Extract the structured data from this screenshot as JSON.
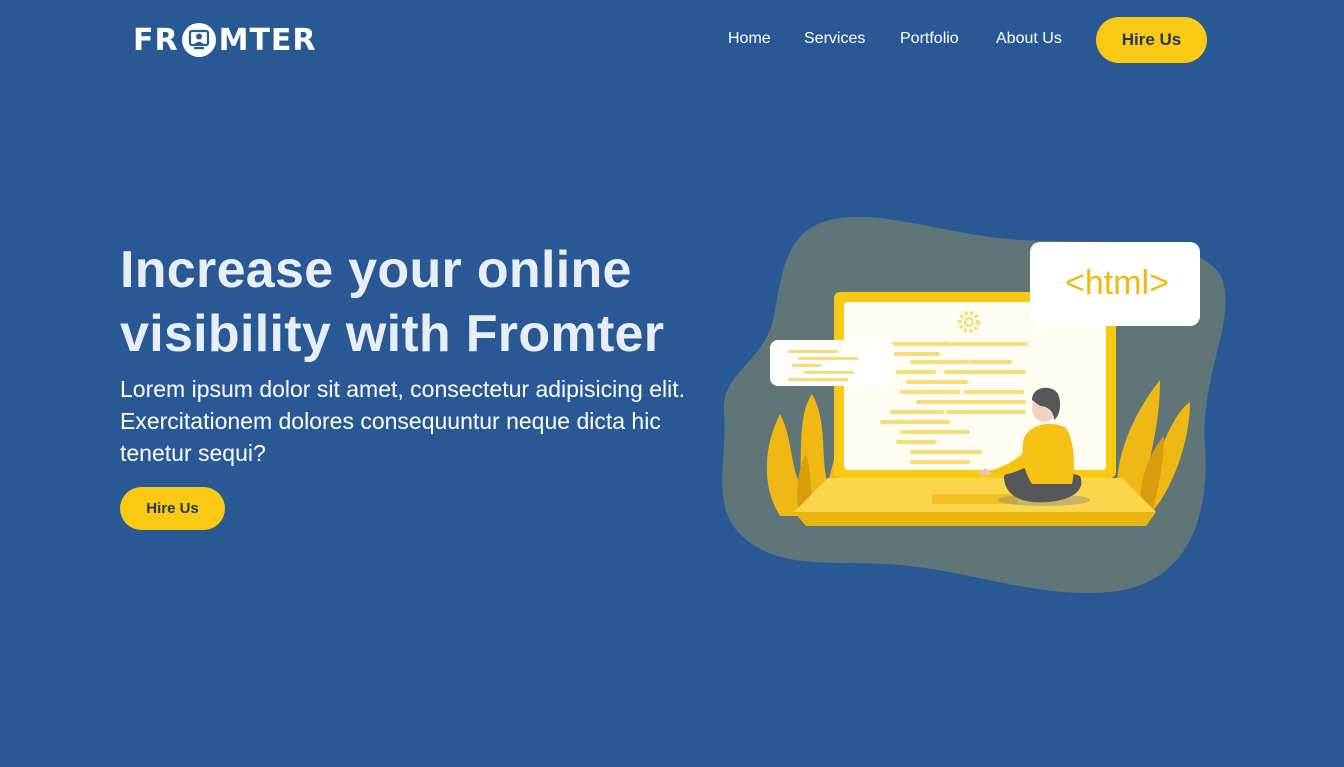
{
  "brand": {
    "logo_prefix": "FR",
    "logo_suffix": "MTER",
    "logo_mark_icon": "monitor-user-icon"
  },
  "nav": {
    "links": [
      "Home",
      "Services",
      "Portfolio",
      "About Us"
    ],
    "cta_label": "Hire Us"
  },
  "hero": {
    "title": "Increase your online visibility with Fromter",
    "body": "Lorem ipsum dolor sit amet, consectetur adipisicing elit. Exercitationem dolores consequuntur neque dicta hic tenetur sequi?",
    "cta_label": "Hire Us"
  },
  "illustration": {
    "code_bubble_text": "<html>",
    "description_icon": "developer-laptop-illustration"
  },
  "colors": {
    "background": "#285995",
    "accent": "#f9c913",
    "blob": "#5f7577",
    "text_light": "#e9eef6",
    "button_text": "#1f3a5f"
  }
}
